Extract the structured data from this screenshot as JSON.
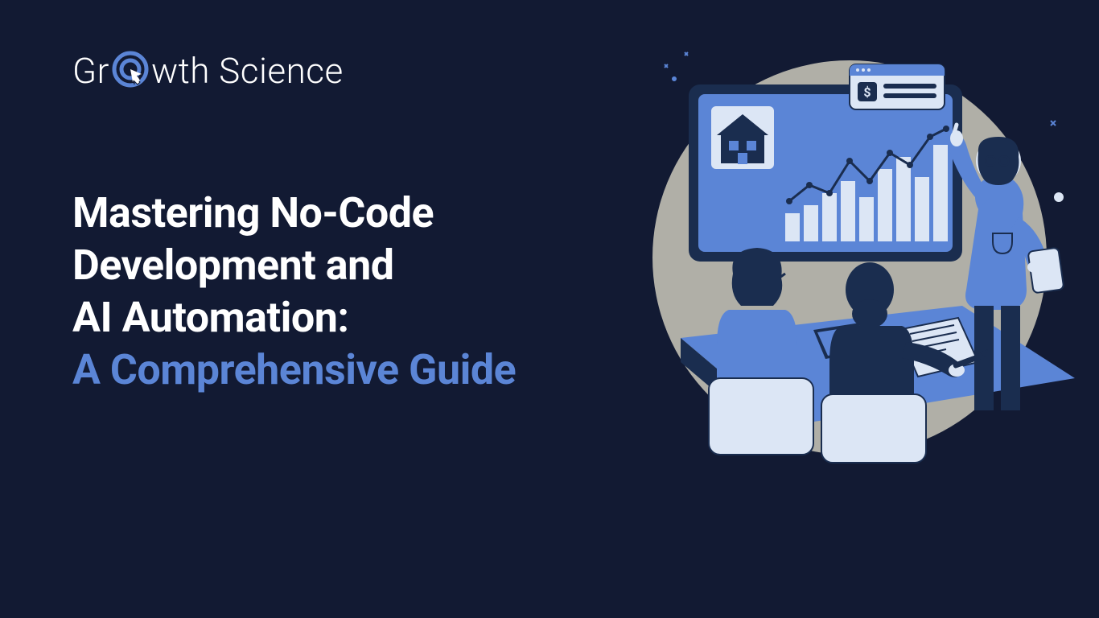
{
  "brand": {
    "name_part1": "Gr",
    "name_part2": "wth Science"
  },
  "headline": {
    "line1": "Mastering No-Code",
    "line2": "Development and",
    "line3": "AI Automation:",
    "line4": "A Comprehensive Guide"
  },
  "colors": {
    "background": "#121a33",
    "text_primary": "#ffffff",
    "accent": "#5b85d6",
    "illustration_bg": "#b0afa7",
    "illustration_dark": "#1a2d4f",
    "illustration_mid": "#5b85d6",
    "illustration_light": "#dce6f5"
  }
}
